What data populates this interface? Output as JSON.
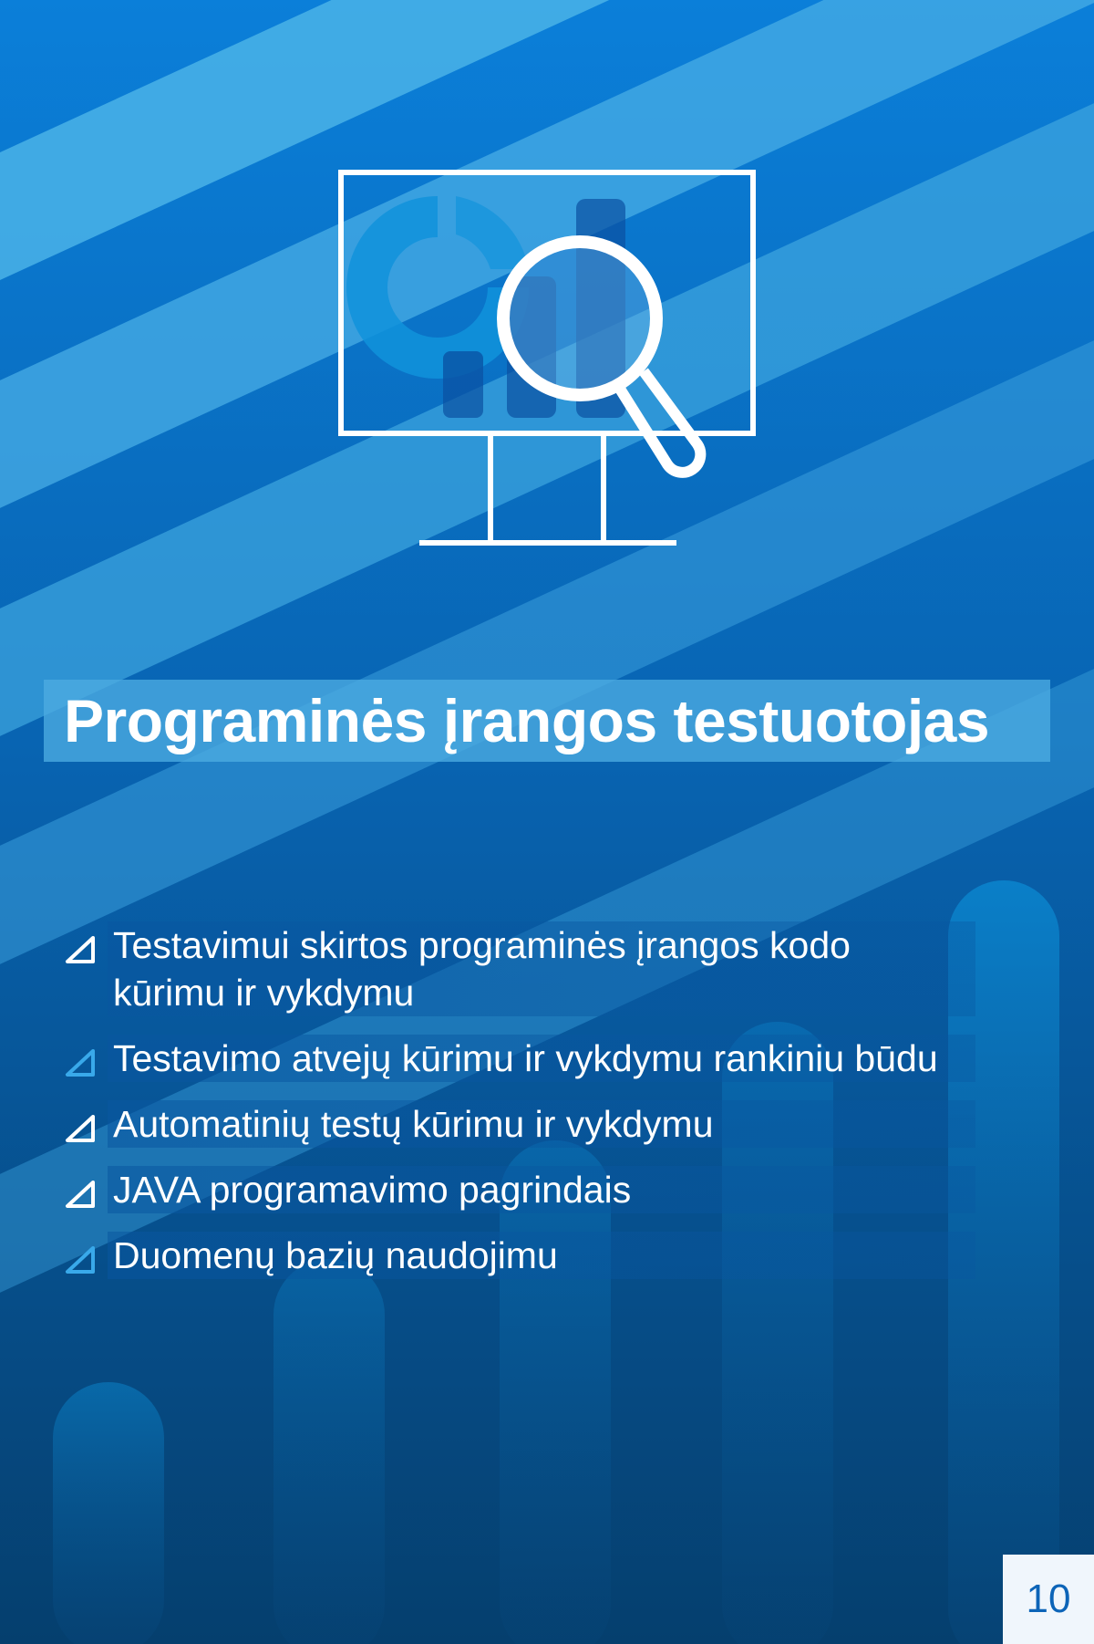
{
  "title": "Programinės įrangos testuotojas",
  "hero_icon": "monitor-chart-magnifier-icon",
  "bullet_icon": "triangle-bullet-icon",
  "bullets": [
    "Testavimui skirtos programinės įrangos kodo kūrimu ir vykdymu",
    "Testavimo atvejų kūrimu ir vykdymu rankiniu būdu",
    "Automatinių testų kūrimu ir vykdymu",
    "JAVA programavimo pagrindais",
    "Duomenų bazių naudojimu"
  ],
  "page_number": "10",
  "colors": {
    "background_dark": "#053f6e",
    "background_mid": "#0a64b4",
    "stripe_light": "#5ec0f0",
    "icon_white": "#ffffff",
    "title_band": "#4dace1",
    "page_number_text": "#0c64b8",
    "page_number_box": "#f0f6fc"
  }
}
